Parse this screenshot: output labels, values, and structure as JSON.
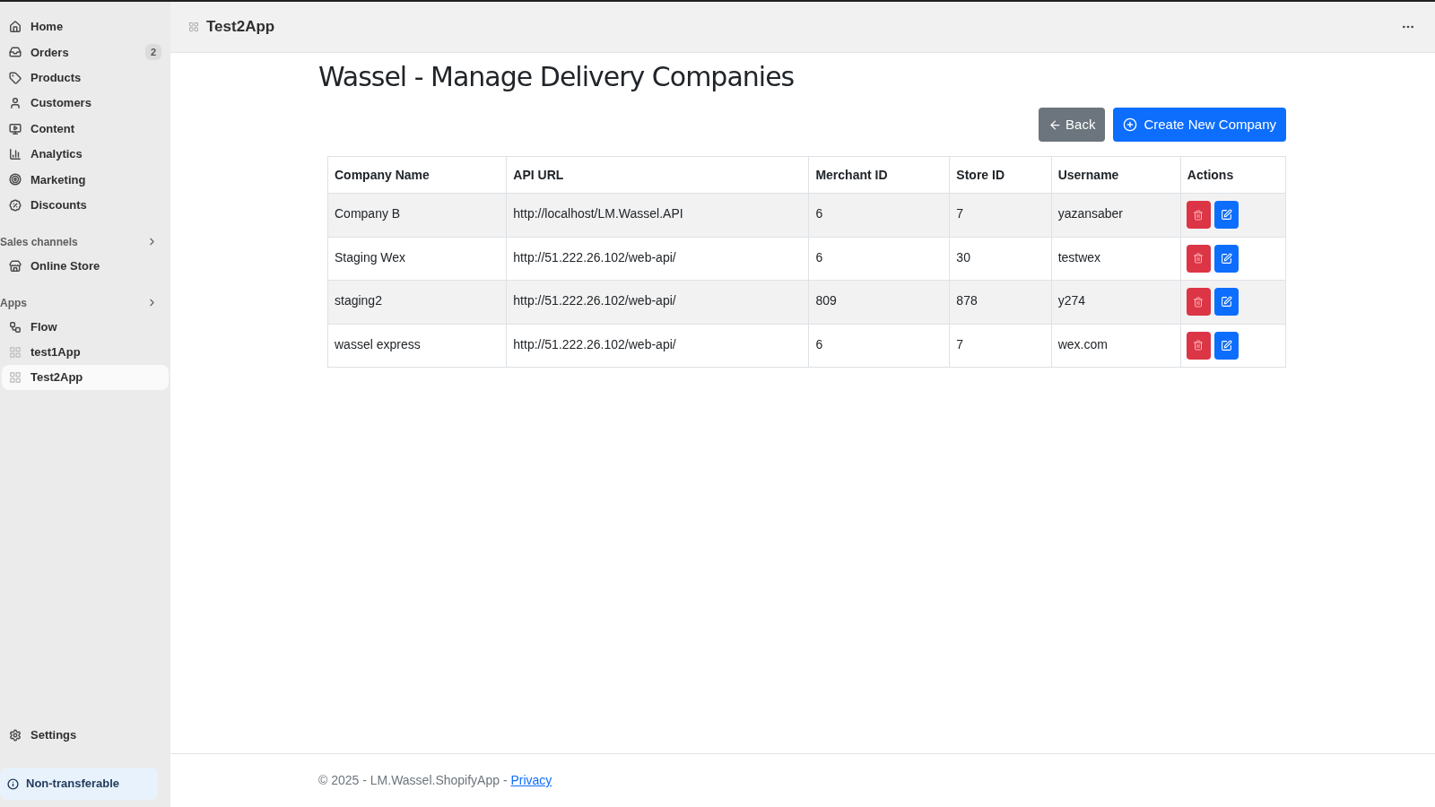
{
  "sidebar": {
    "items": [
      {
        "label": "Home",
        "selected": false
      },
      {
        "label": "Orders",
        "badge": "2",
        "selected": false
      },
      {
        "label": "Products",
        "selected": false
      },
      {
        "label": "Customers",
        "selected": false
      },
      {
        "label": "Content",
        "selected": false
      },
      {
        "label": "Analytics",
        "selected": false
      },
      {
        "label": "Marketing",
        "selected": false
      },
      {
        "label": "Discounts",
        "selected": false
      }
    ],
    "sections": [
      {
        "title": "Sales channels",
        "items": [
          {
            "label": "Online Store",
            "selected": false
          }
        ]
      },
      {
        "title": "Apps",
        "items": [
          {
            "label": "Flow",
            "selected": false
          },
          {
            "label": "test1App",
            "selected": false
          },
          {
            "label": "Test2App",
            "selected": true
          }
        ]
      }
    ],
    "settings": "Settings",
    "notice": "Non-transferable"
  },
  "header": {
    "app_title": "Test2App"
  },
  "page": {
    "title": "Wassel - Manage Delivery Companies",
    "back_button": "Back",
    "create_button": "Create New Company"
  },
  "table": {
    "columns": [
      "Company Name",
      "API URL",
      "Merchant ID",
      "Store ID",
      "Username",
      "Actions"
    ],
    "rows": [
      [
        "Company B",
        "http://localhost/LM.Wassel.API",
        "6",
        "7",
        "yazansaber"
      ],
      [
        "Staging Wex",
        "http://51.222.26.102/web-api/",
        "6",
        "30",
        "testwex"
      ],
      [
        "staging2",
        "http://51.222.26.102/web-api/",
        "809",
        "878",
        "y274"
      ],
      [
        "wassel express",
        "http://51.222.26.102/web-api/",
        "6",
        "7",
        "wex.com"
      ]
    ]
  },
  "footer": {
    "text": "© 2025 - LM.Wassel.ShopifyApp - ",
    "link": "Privacy"
  }
}
